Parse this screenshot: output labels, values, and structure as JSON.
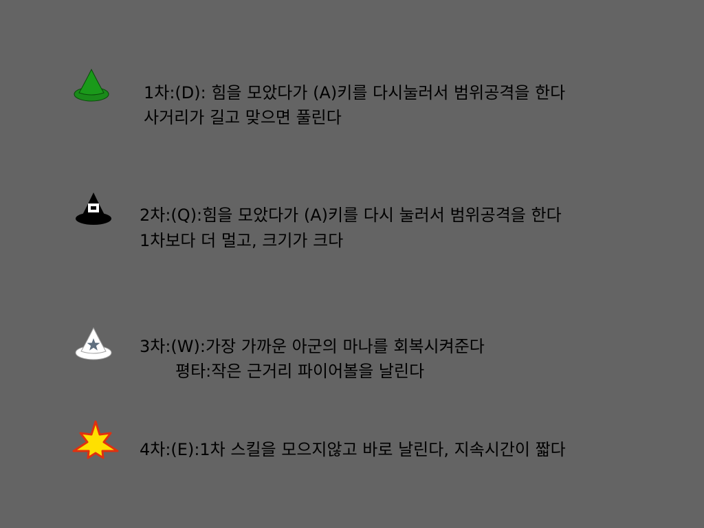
{
  "skills": [
    {
      "icon": "green-witch-hat-icon",
      "icon_color": "#1a8a1a",
      "lines": [
        "1차:(D): 힘을 모았다가 (A)키를 다시눌러서 범위공격을 한다",
        "사거리가 길고 맞으면 풀린다"
      ]
    },
    {
      "icon": "black-witch-hat-icon",
      "icon_color": "#000000",
      "lines": [
        "2차:(Q):힘을 모았다가 (A)키를 다시 눌러서 범위공격을 한다",
        "1차보다 더 멀고, 크기가 크다"
      ]
    },
    {
      "icon": "white-star-witch-hat-icon",
      "icon_color": "#ffffff",
      "lines": [
        "3차:(W):가장 가까운 아군의 마나를 회복시켜준다",
        "평타:작은 근거리 파이어볼을 날린다"
      ]
    },
    {
      "icon": "yellow-star-burst-icon",
      "icon_color": "#ffd700",
      "lines": [
        "4차:(E):1차 스킬을 모으지않고 바로 날린다, 지속시간이 짧다"
      ]
    }
  ]
}
